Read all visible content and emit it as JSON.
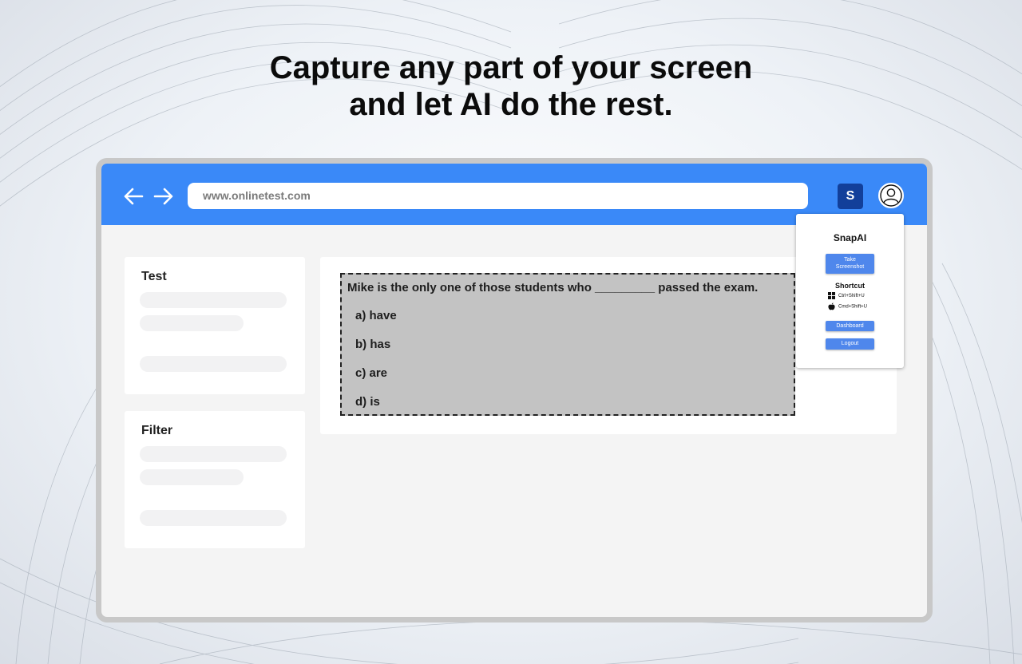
{
  "headline": {
    "line1": "Capture any part of your screen",
    "line2": "and let AI do the rest."
  },
  "browser": {
    "url": "www.onlinetest.com",
    "extension_label": "S"
  },
  "sidebar": {
    "test_title": "Test",
    "filter_title": "Filter"
  },
  "quiz": {
    "question": "Mike is the only one of those students who _________ passed the exam.",
    "options": [
      "a) have",
      "b) has",
      "c) are",
      "d) is"
    ]
  },
  "popup": {
    "title": "SnapAI",
    "take_screenshot": [
      "Take",
      "Screenshot"
    ],
    "shortcut_title": "Shortcut",
    "windows_shortcut": "Ctrl+Shift+U",
    "mac_shortcut": "Cmd+Shift+U",
    "dashboard": "Dashboard",
    "logout": "Logout"
  },
  "colors": {
    "topbar": "#3a89f8",
    "extension_button": "#123f9a",
    "popup_button": "#4f87ec",
    "selection_fill": "#c3c3c3"
  }
}
